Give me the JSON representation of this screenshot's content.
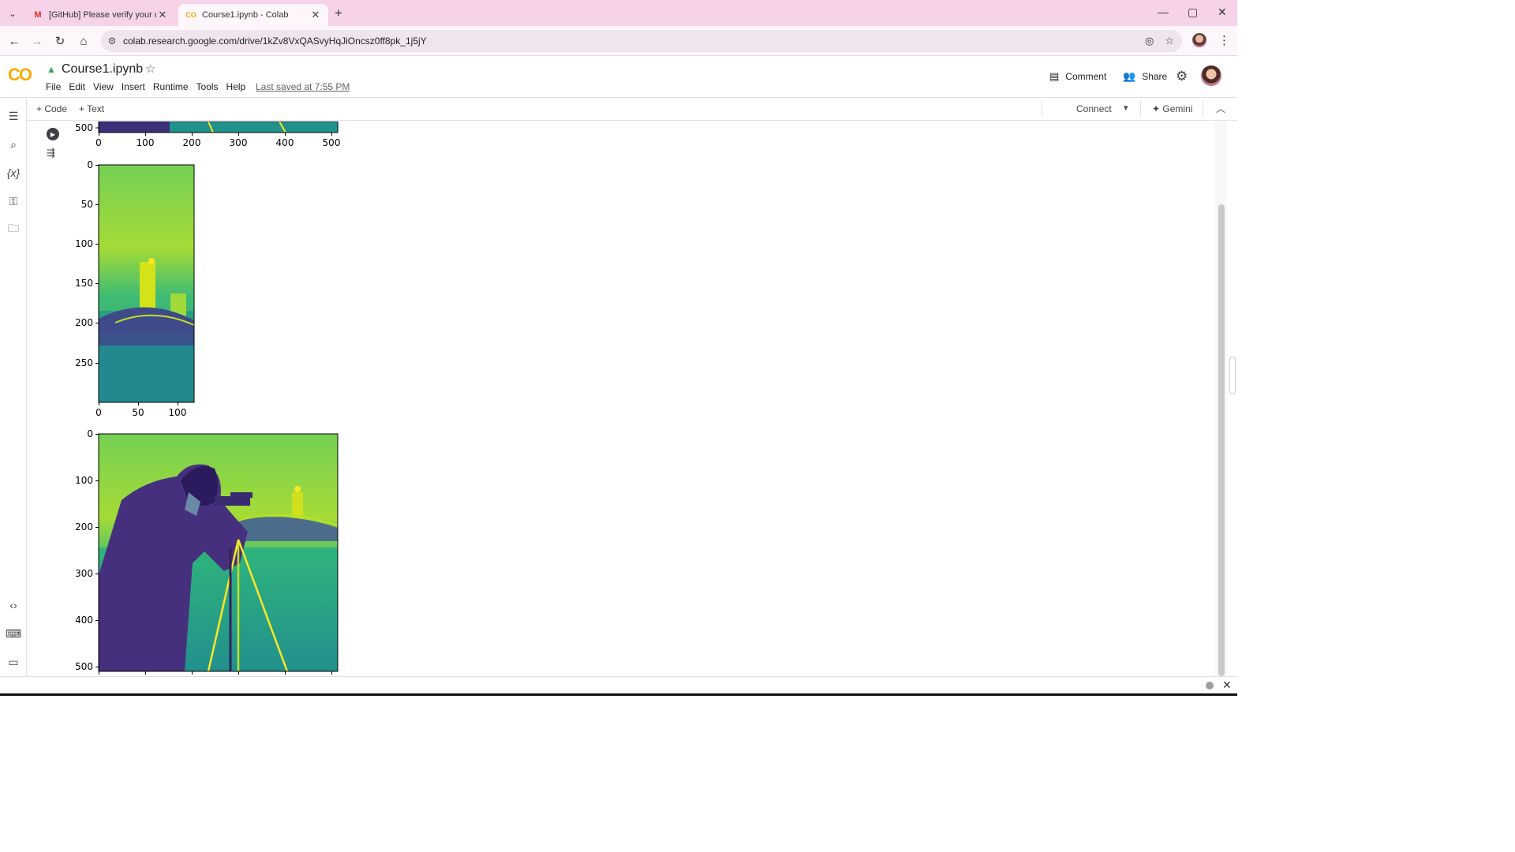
{
  "browser": {
    "tabs": [
      {
        "favicon": "M",
        "title": "[GitHub] Please verify your dev",
        "close": "✕"
      },
      {
        "favicon": "CO",
        "title": "Course1.ipynb - Colab",
        "close": "✕"
      }
    ],
    "new_tab": "+",
    "url": "colab.research.google.com/drive/1kZv8VxQASvyHqJiOncsz0ff8pk_1j5jY",
    "window_controls": {
      "minimize": "—",
      "maximize": "▢",
      "close": "✕"
    }
  },
  "colab": {
    "logo": "CO",
    "notebook_title": "Course1.ipynb",
    "menu": [
      "File",
      "Edit",
      "View",
      "Insert",
      "Runtime",
      "Tools",
      "Help"
    ],
    "last_saved": "Last saved at 7:55 PM",
    "comment_label": "Comment",
    "share_label": "Share",
    "toolbar": {
      "add_code": "+ Code",
      "add_text": "+ Text",
      "connect": "Connect",
      "gemini": "✦ Gemini"
    }
  },
  "plots": {
    "top_partial": {
      "y_tick": "500",
      "x_ticks": [
        "0",
        "100",
        "200",
        "300",
        "400",
        "500"
      ]
    },
    "cropped": {
      "y_ticks": [
        "0",
        "50",
        "100",
        "150",
        "200",
        "250"
      ],
      "x_ticks": [
        "0",
        "50",
        "100"
      ]
    },
    "full": {
      "y_ticks": [
        "0",
        "100",
        "200",
        "300",
        "400",
        "500"
      ]
    }
  },
  "icons": {
    "rail": [
      "toc-icon",
      "search-icon",
      "variables-icon",
      "secrets-key-icon",
      "files-folder-icon",
      "code-snippets-icon",
      "command-palette-icon",
      "terminal-icon"
    ]
  }
}
